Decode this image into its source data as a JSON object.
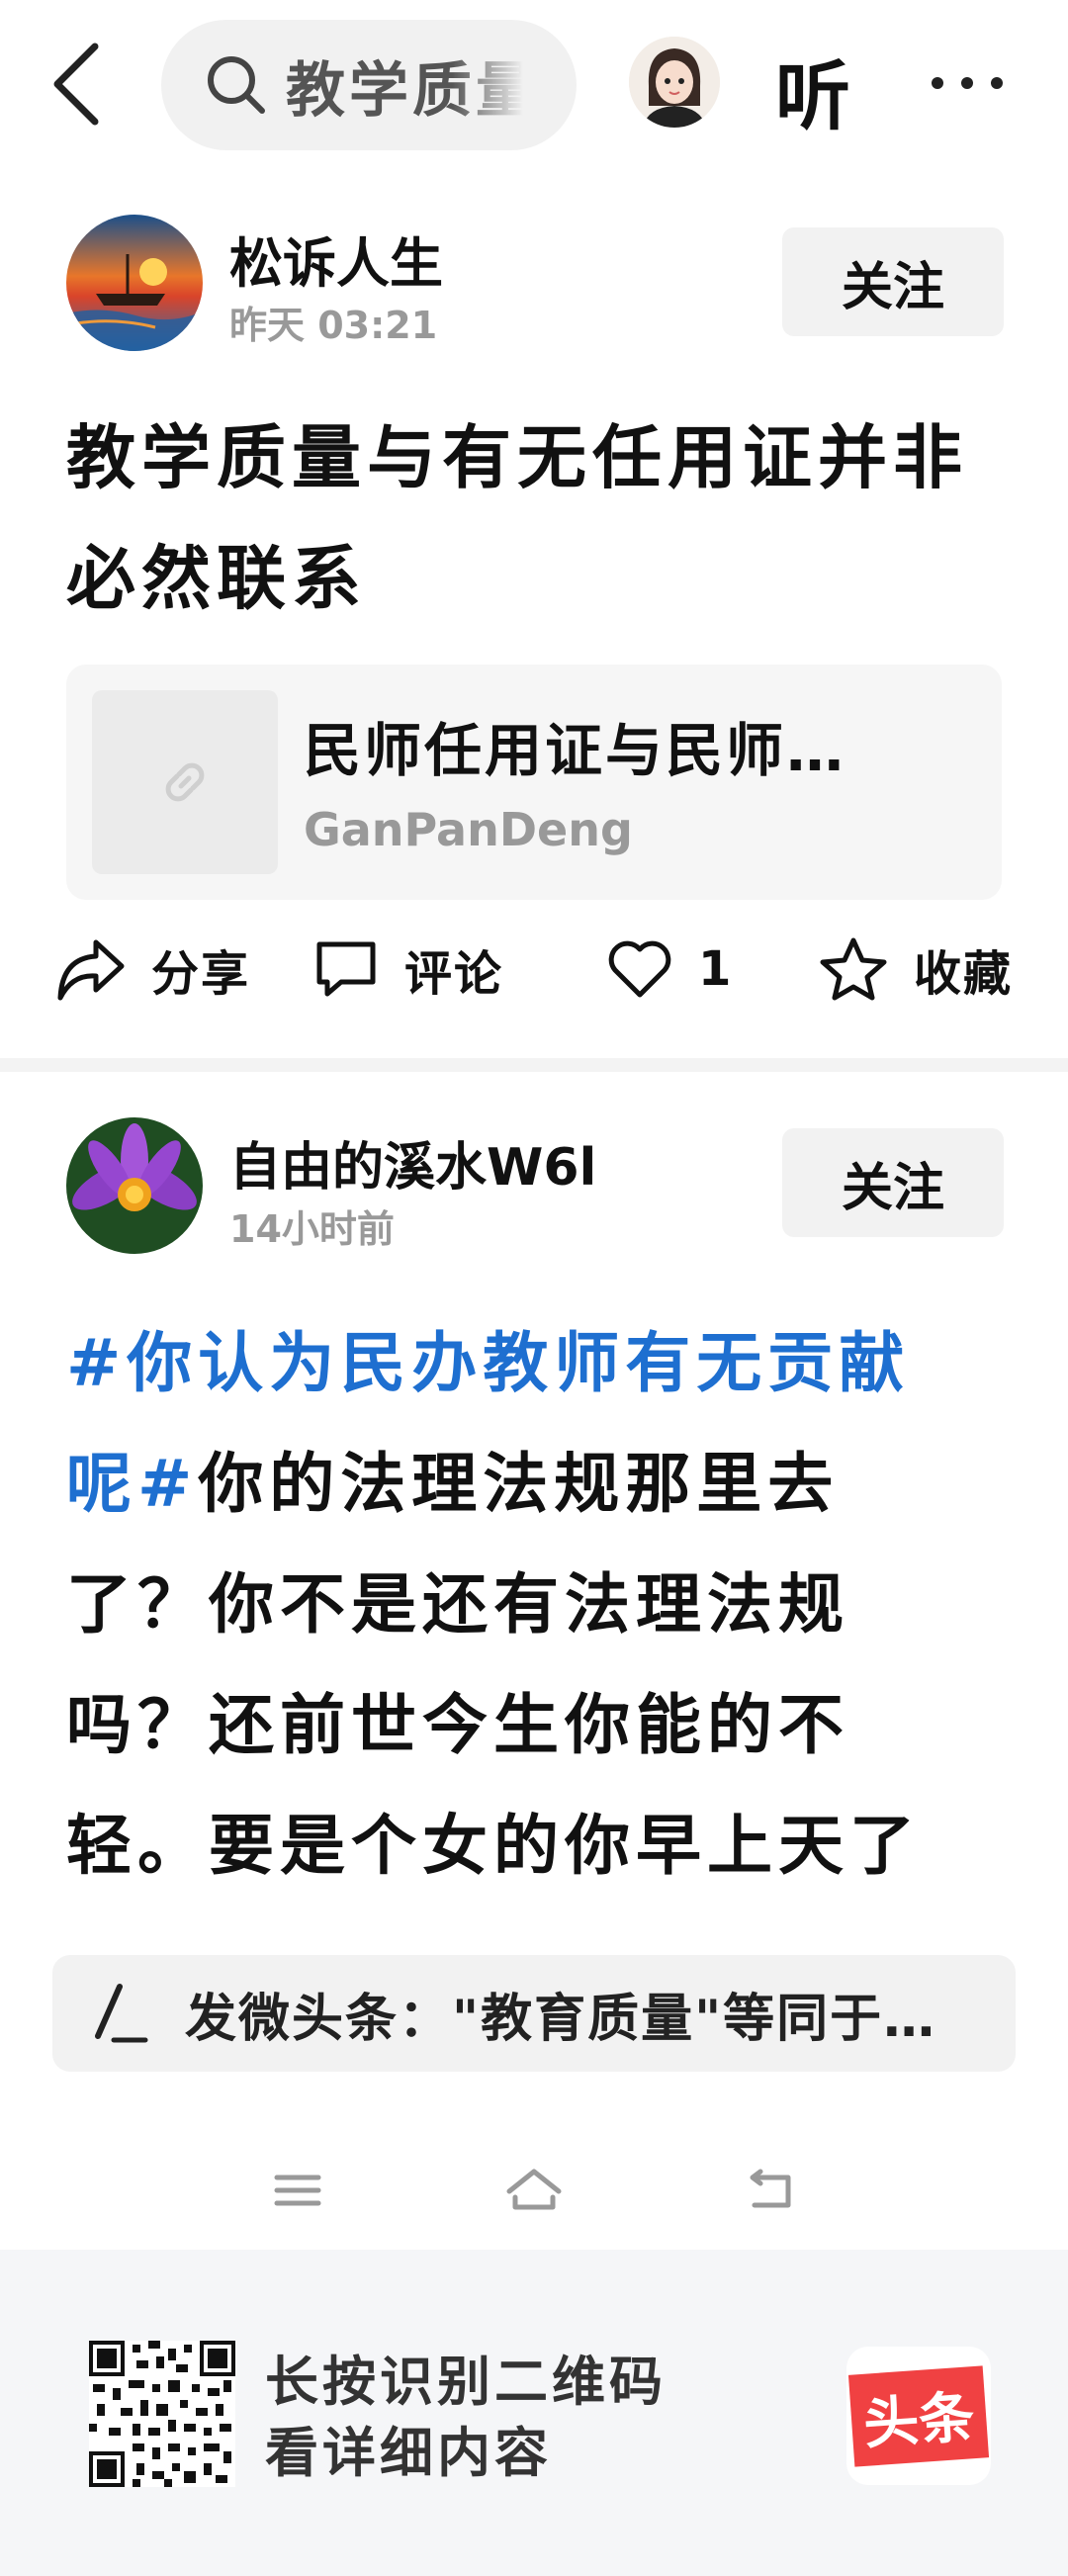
{
  "topbar": {
    "search_text": "教学质量",
    "listen_label": "听"
  },
  "post1": {
    "author": "松诉人生",
    "time": "昨天  03:21",
    "follow_label": "关注",
    "title": "教学质量与有无任用证并非必然联系",
    "link_card": {
      "title": "民师任用证与民师…",
      "source": "GanPanDeng"
    },
    "actions": {
      "share": "分享",
      "comment": "评论",
      "like_count": "1",
      "favorite": "收藏"
    }
  },
  "post2": {
    "author": "自由的溪水W6l",
    "time": "14小时前",
    "follow_label": "关注",
    "hashtag": "#你认为民办教师有无贡献呢#",
    "body": "你的法理法规那里去了？你不是还有法理法规吗？还前世今生你能的不轻。要是个女的你早上天了"
  },
  "comment_bar": {
    "text": "发微头条：\"教育质量\"等同于…"
  },
  "footer": {
    "line1": "长按识别二维码",
    "line2": "看详细内容",
    "logo_text": "头条"
  },
  "colors": {
    "hashtag": "#1e6fd0",
    "brand_red": "#f04142"
  }
}
